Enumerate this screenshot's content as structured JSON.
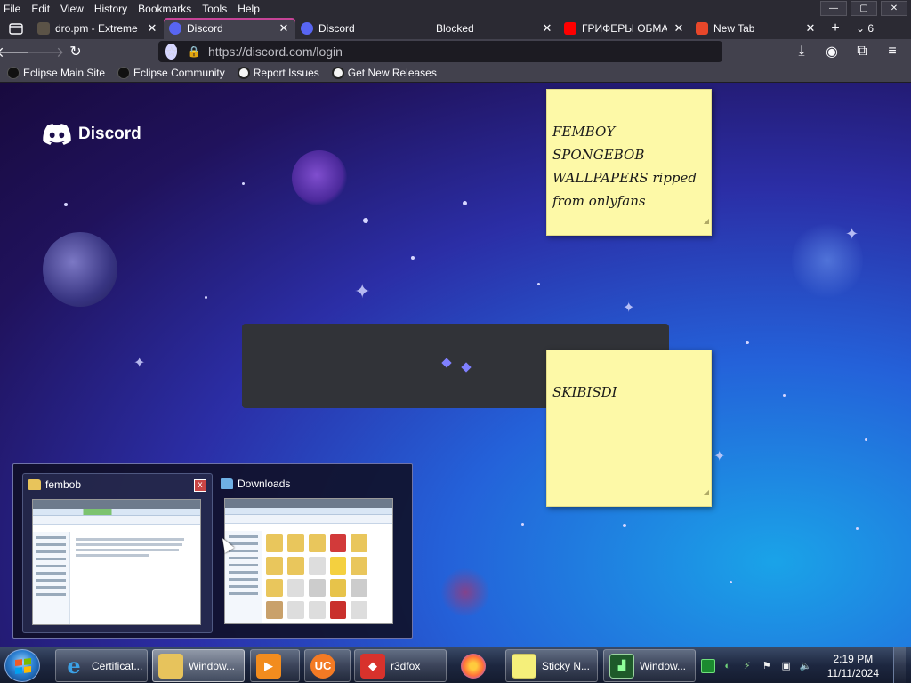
{
  "menu": [
    "File",
    "Edit",
    "View",
    "History",
    "Bookmarks",
    "Tools",
    "Help"
  ],
  "window_controls": {
    "minimize": "—",
    "maximize": "▢",
    "close": "✕"
  },
  "tabs": [
    {
      "label": "dro.pm - Extreme",
      "close": "✕",
      "favicon_color": "#5b5347"
    },
    {
      "label": "Discord",
      "close": "✕",
      "favicon_color": "#5865f2",
      "active": true
    },
    {
      "label": "Discord",
      "close": "",
      "favicon_color": "#5865f2"
    },
    {
      "label": "Blocked",
      "close": "✕",
      "favicon_color": ""
    },
    {
      "label": "ГРИФЕРЫ ОБМА",
      "close": "✕",
      "favicon_color": "#ff0000"
    },
    {
      "label": "New Tab",
      "close": "✕",
      "favicon_color": "#e8472a"
    }
  ],
  "tab_list_count": "6",
  "tab_new": "+",
  "url": "https://discord.com/login",
  "bookmarks": [
    {
      "label": "Eclipse Main Site",
      "icon": "eclipse-icon"
    },
    {
      "label": "Eclipse Community",
      "icon": "eclipse-icon"
    },
    {
      "label": "Report Issues",
      "icon": "github-icon"
    },
    {
      "label": "Get New Releases",
      "icon": "github-icon"
    }
  ],
  "discord": {
    "logo_text": "Discord",
    "brand_color": "#5865f2"
  },
  "sticky_notes": [
    {
      "text": "FEMBOY SPONGEBOB WALLPAPERS ripped from onlyfans"
    },
    {
      "text": "SKIBISDI"
    }
  ],
  "thumbnails": [
    {
      "title": "fembob",
      "close": "x"
    },
    {
      "title": "Downloads"
    }
  ],
  "taskbar": {
    "items": [
      {
        "label": "Certificat...",
        "icon": "internet-explorer-icon"
      },
      {
        "label": "Window...",
        "icon": "windows-explorer-icon",
        "active": true
      },
      {
        "label": "",
        "icon": "media-player-icon"
      },
      {
        "label": "",
        "icon": "uc-browser-icon"
      },
      {
        "label": "r3dfox",
        "icon": "r3dfox-icon"
      },
      {
        "label": "",
        "icon": "firefox-icon"
      },
      {
        "label": "Sticky N...",
        "icon": "sticky-notes-icon"
      },
      {
        "label": "Window...",
        "icon": "task-manager-icon"
      }
    ],
    "time": "2:19 PM",
    "date": "11/11/2024"
  }
}
